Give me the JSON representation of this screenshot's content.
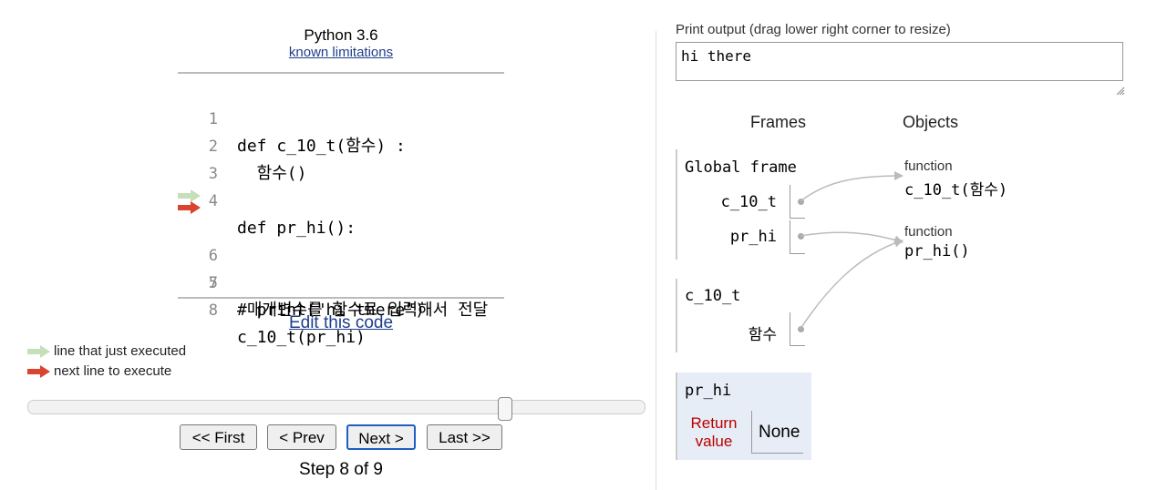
{
  "header": {
    "language": "Python 3.6",
    "limitations_link": "known limitations"
  },
  "code": {
    "lines": [
      {
        "num": "1",
        "text": "def c_10_t(함수) :"
      },
      {
        "num": "2",
        "text": "  함수()"
      },
      {
        "num": "3",
        "text": ""
      },
      {
        "num": "4",
        "text": "def pr_hi():"
      },
      {
        "num": "5",
        "text": "  print(\"hi there\")"
      },
      {
        "num": "6",
        "text": ""
      },
      {
        "num": "7",
        "text": "#매개변수를 함수로 입력해서 전달"
      },
      {
        "num": "8",
        "text": "c_10_t(pr_hi)"
      }
    ],
    "edit_link": "Edit this code"
  },
  "legend": {
    "just_executed": "line that just executed",
    "next_line": "next line to execute"
  },
  "colors": {
    "just_executed_arrow": "#c5e0b9",
    "next_line_arrow": "#d9432f",
    "return_label": "#b00000",
    "active_frame_bg": "#e6edf6",
    "link": "#1f3e8c"
  },
  "navigation": {
    "first": "<< First",
    "prev": "< Prev",
    "next": "Next >",
    "last": "Last >>",
    "step": "Step 8 of 9",
    "progress_fraction": 0.78
  },
  "output": {
    "label": "Print output (drag lower right corner to resize)",
    "text": "hi there"
  },
  "visualizer": {
    "frames_header": "Frames",
    "objects_header": "Objects",
    "global_frame": {
      "title": "Global frame",
      "vars": [
        "c_10_t",
        "pr_hi"
      ]
    },
    "frame_c10t": {
      "title": "c_10_t",
      "vars": [
        "함수"
      ]
    },
    "frame_prhi": {
      "title": "pr_hi",
      "return_label_1": "Return",
      "return_label_2": "value",
      "return_value": "None"
    },
    "objects": [
      {
        "type": "function",
        "name": "c_10_t(함수)"
      },
      {
        "type": "function",
        "name": "pr_hi()"
      }
    ]
  }
}
